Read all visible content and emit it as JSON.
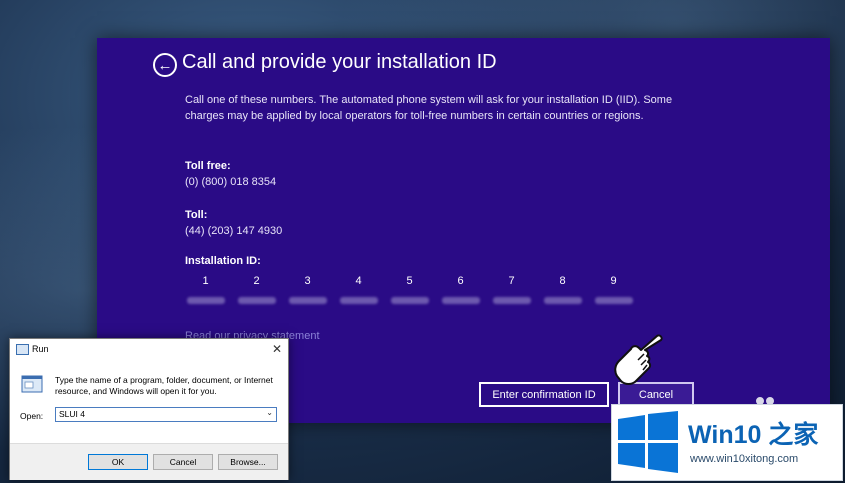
{
  "activation": {
    "title": "Call and provide your installation ID",
    "intro": "Call one of these numbers. The automated phone system will ask for your installation ID (IID). Some charges may be applied by local operators for toll-free numbers in certain countries or regions.",
    "toll_free_label": "Toll free:",
    "toll_free_number": "(0) (800) 018 8354",
    "toll_label": "Toll:",
    "toll_number": "(44) (203) 147 4930",
    "installation_id_label": "Installation ID:",
    "iid_columns": [
      "1",
      "2",
      "3",
      "4",
      "5",
      "6",
      "7",
      "8",
      "9"
    ],
    "privacy_link": "Read our privacy statement",
    "confirm_button": "Enter confirmation ID",
    "cancel_button": "Cancel"
  },
  "run_dialog": {
    "title": "Run",
    "description": "Type the name of a program, folder, document, or Internet resource, and Windows will open it for you.",
    "open_label": "Open:",
    "open_value": "SLUI 4",
    "ok_button": "OK",
    "cancel_button": "Cancel",
    "browse_button": "Browse..."
  },
  "watermark": {
    "main_text": "Win10 之家",
    "url": "www.win10xitong.com"
  },
  "colors": {
    "activation_bg": "#2a0b86",
    "link": "#8c82d8",
    "watermark_blue": "#0b63b4"
  }
}
